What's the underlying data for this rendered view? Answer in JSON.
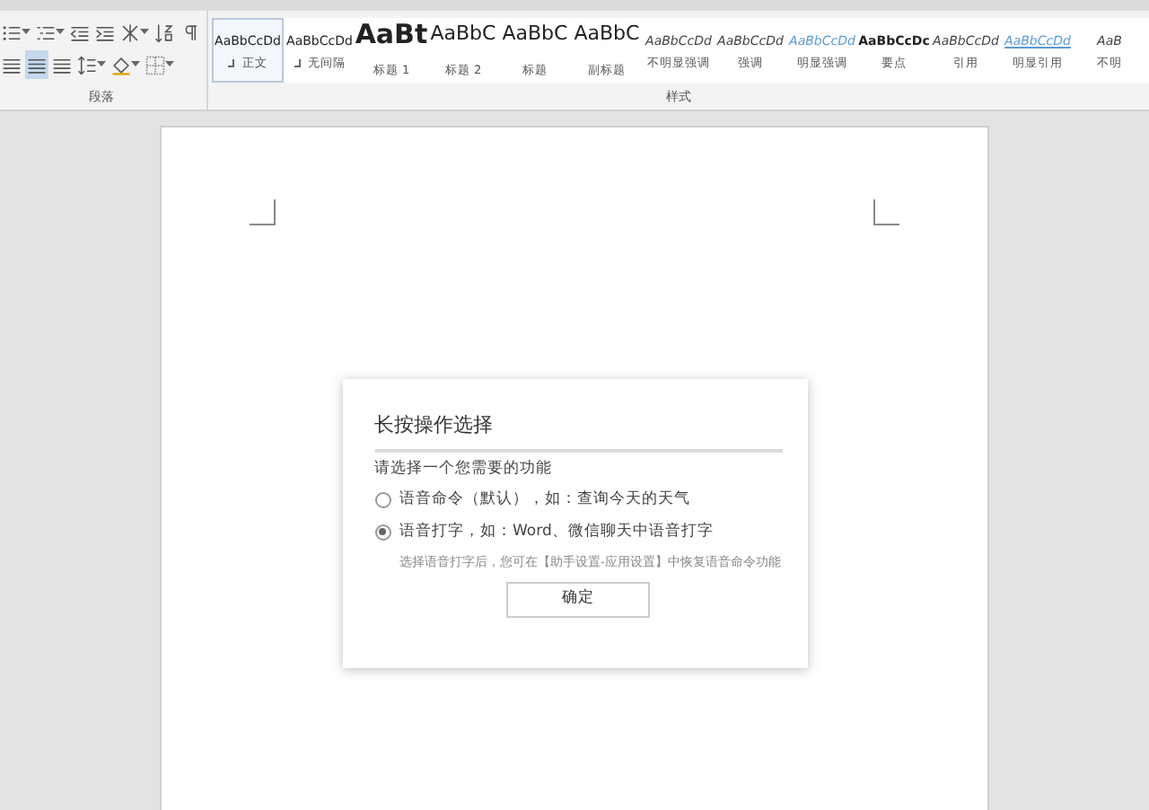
{
  "ribbon": {
    "paragraph_group": {
      "label": "段落",
      "tools_row_1": [
        {
          "kind": "list",
          "dropdown": true
        },
        {
          "kind": "multilevel",
          "dropdown": true
        },
        {
          "kind": "outdent",
          "dropdown": false
        },
        {
          "kind": "indent",
          "dropdown": false
        },
        {
          "kind": "asian-layout",
          "dropdown": true
        },
        {
          "kind": "sort",
          "dropdown": false
        },
        {
          "kind": "marks",
          "dropdown": false
        }
      ],
      "tools_row_2": [
        {
          "kind": "align",
          "selected": false,
          "dropdown": false
        },
        {
          "kind": "align",
          "selected": true,
          "dropdown": false
        },
        {
          "kind": "align",
          "selected": false,
          "dropdown": false
        },
        {
          "kind": "spacing",
          "selected": false,
          "dropdown": true
        },
        {
          "kind": "shading",
          "selected": false,
          "dropdown": true
        },
        {
          "kind": "border",
          "selected": false,
          "dropdown": true
        }
      ]
    },
    "styles_group": {
      "label": "样式",
      "styles": [
        {
          "preview": "AaBbCcDd",
          "name": "正文",
          "kind": "normal",
          "selected": true,
          "mark": true
        },
        {
          "preview": "AaBbCcDd",
          "name": "无间隔",
          "kind": "normal",
          "selected": false,
          "mark": true
        },
        {
          "preview": "AaBt",
          "name": "标题 1",
          "kind": "heading1",
          "selected": false,
          "mark": false
        },
        {
          "preview": "AaBbC",
          "name": "标题 2",
          "kind": "heading2",
          "selected": false,
          "mark": false
        },
        {
          "preview": "AaBbC",
          "name": "标题",
          "kind": "heading2",
          "selected": false,
          "mark": false
        },
        {
          "preview": "AaBbC",
          "name": "副标题",
          "kind": "heading2",
          "selected": false,
          "mark": false
        },
        {
          "preview": "AaBbCcDd",
          "name": "不明显强调",
          "kind": "subtle",
          "selected": false,
          "mark": false
        },
        {
          "preview": "AaBbCcDd",
          "name": "强调",
          "kind": "emphasis",
          "selected": false,
          "mark": false
        },
        {
          "preview": "AaBbCcDd",
          "name": "明显强调",
          "kind": "intense",
          "selected": false,
          "mark": false
        },
        {
          "preview": "AaBbCcDc",
          "name": "要点",
          "kind": "strong",
          "selected": false,
          "mark": false
        },
        {
          "preview": "AaBbCcDd",
          "name": "引用",
          "kind": "subtle",
          "selected": false,
          "mark": false
        },
        {
          "preview": "AaBbCcDd",
          "name": "明显引用",
          "kind": "intense-quote",
          "selected": false,
          "mark": false
        },
        {
          "preview": "AaB",
          "name": "不明",
          "kind": "subtle",
          "selected": false,
          "mark": false
        }
      ]
    }
  },
  "dialog": {
    "title": "长按操作选择",
    "prompt": "请选择一个您需要的功能",
    "options": [
      {
        "label": "语音命令（默认），如：查询今天的天气",
        "selected": false
      },
      {
        "label": "语音打字，如：Word、微信聊天中语音打字",
        "selected": true
      }
    ],
    "note": "选择语音打字后，您可在【助手设置-应用设置】中恢复语音命令功能",
    "button": "确定"
  }
}
